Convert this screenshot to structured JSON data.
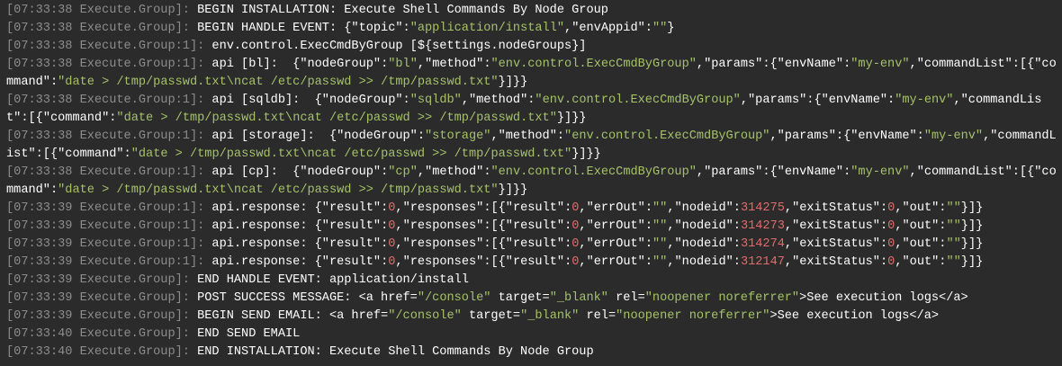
{
  "colors": {
    "background": "#2b2b2b",
    "timestamp": "#8c8c8c",
    "text": "#ffffff",
    "string": "#a5c26a",
    "number": "#e06c6c"
  },
  "lines": [
    {
      "prefix": "[07:33:38 Execute.Group]:",
      "segments": [
        {
          "t": "p",
          "v": " BEGIN INSTALLATION: Execute Shell Commands By Node Group"
        }
      ]
    },
    {
      "prefix": "[07:33:38 Execute.Group]:",
      "segments": [
        {
          "t": "p",
          "v": " BEGIN HANDLE EVENT: {"
        },
        {
          "t": "k",
          "v": "\"topic\""
        },
        {
          "t": "p",
          "v": ":"
        },
        {
          "t": "s",
          "v": "\"application/install\""
        },
        {
          "t": "p",
          "v": ","
        },
        {
          "t": "k",
          "v": "\"envAppid\""
        },
        {
          "t": "p",
          "v": ":"
        },
        {
          "t": "s",
          "v": "\"\""
        },
        {
          "t": "p",
          "v": "}"
        }
      ]
    },
    {
      "prefix": "[07:33:38 Execute.Group:1]:",
      "segments": [
        {
          "t": "p",
          "v": " env.control.ExecCmdByGroup [${settings.nodeGroups}]"
        }
      ]
    },
    {
      "prefix": "[07:33:38 Execute.Group:1]:",
      "segments": [
        {
          "t": "p",
          "v": " api [bl]:  {"
        },
        {
          "t": "k",
          "v": "\"nodeGroup\""
        },
        {
          "t": "p",
          "v": ":"
        },
        {
          "t": "s",
          "v": "\"bl\""
        },
        {
          "t": "p",
          "v": ","
        },
        {
          "t": "k",
          "v": "\"method\""
        },
        {
          "t": "p",
          "v": ":"
        },
        {
          "t": "s",
          "v": "\"env.control.ExecCmdByGroup\""
        },
        {
          "t": "p",
          "v": ","
        },
        {
          "t": "k",
          "v": "\"params\""
        },
        {
          "t": "p",
          "v": ":{"
        },
        {
          "t": "k",
          "v": "\"envName\""
        },
        {
          "t": "p",
          "v": ":"
        },
        {
          "t": "s",
          "v": "\"my-env\""
        },
        {
          "t": "p",
          "v": ","
        },
        {
          "t": "k",
          "v": "\"commandList\""
        },
        {
          "t": "p",
          "v": ":[{"
        },
        {
          "t": "k",
          "v": "\"command\""
        },
        {
          "t": "p",
          "v": ":"
        },
        {
          "t": "s",
          "v": "\"date > /tmp/passwd.txt\\ncat /etc/passwd >> /tmp/passwd.txt\""
        },
        {
          "t": "p",
          "v": "}]}}"
        }
      ]
    },
    {
      "prefix": "[07:33:38 Execute.Group:1]:",
      "segments": [
        {
          "t": "p",
          "v": " api [sqldb]:  {"
        },
        {
          "t": "k",
          "v": "\"nodeGroup\""
        },
        {
          "t": "p",
          "v": ":"
        },
        {
          "t": "s",
          "v": "\"sqldb\""
        },
        {
          "t": "p",
          "v": ","
        },
        {
          "t": "k",
          "v": "\"method\""
        },
        {
          "t": "p",
          "v": ":"
        },
        {
          "t": "s",
          "v": "\"env.control.ExecCmdByGroup\""
        },
        {
          "t": "p",
          "v": ","
        },
        {
          "t": "k",
          "v": "\"params\""
        },
        {
          "t": "p",
          "v": ":{"
        },
        {
          "t": "k",
          "v": "\"envName\""
        },
        {
          "t": "p",
          "v": ":"
        },
        {
          "t": "s",
          "v": "\"my-env\""
        },
        {
          "t": "p",
          "v": ","
        },
        {
          "t": "k",
          "v": "\"commandList\""
        },
        {
          "t": "p",
          "v": ":[{"
        },
        {
          "t": "k",
          "v": "\"command\""
        },
        {
          "t": "p",
          "v": ":"
        },
        {
          "t": "s",
          "v": "\"date > /tmp/passwd.txt\\ncat /etc/passwd >> /tmp/passwd.txt\""
        },
        {
          "t": "p",
          "v": "}]}}"
        }
      ]
    },
    {
      "prefix": "[07:33:38 Execute.Group:1]:",
      "segments": [
        {
          "t": "p",
          "v": " api [storage]:  {"
        },
        {
          "t": "k",
          "v": "\"nodeGroup\""
        },
        {
          "t": "p",
          "v": ":"
        },
        {
          "t": "s",
          "v": "\"storage\""
        },
        {
          "t": "p",
          "v": ","
        },
        {
          "t": "k",
          "v": "\"method\""
        },
        {
          "t": "p",
          "v": ":"
        },
        {
          "t": "s",
          "v": "\"env.control.ExecCmdByGroup\""
        },
        {
          "t": "p",
          "v": ","
        },
        {
          "t": "k",
          "v": "\"params\""
        },
        {
          "t": "p",
          "v": ":{"
        },
        {
          "t": "k",
          "v": "\"envName\""
        },
        {
          "t": "p",
          "v": ":"
        },
        {
          "t": "s",
          "v": "\"my-env\""
        },
        {
          "t": "p",
          "v": ","
        },
        {
          "t": "k",
          "v": "\"commandList\""
        },
        {
          "t": "p",
          "v": ":[{"
        },
        {
          "t": "k",
          "v": "\"command\""
        },
        {
          "t": "p",
          "v": ":"
        },
        {
          "t": "s",
          "v": "\"date > /tmp/passwd.txt\\ncat /etc/passwd >> /tmp/passwd.txt\""
        },
        {
          "t": "p",
          "v": "}]}}"
        }
      ]
    },
    {
      "prefix": "[07:33:38 Execute.Group:1]:",
      "segments": [
        {
          "t": "p",
          "v": " api [cp]:  {"
        },
        {
          "t": "k",
          "v": "\"nodeGroup\""
        },
        {
          "t": "p",
          "v": ":"
        },
        {
          "t": "s",
          "v": "\"cp\""
        },
        {
          "t": "p",
          "v": ","
        },
        {
          "t": "k",
          "v": "\"method\""
        },
        {
          "t": "p",
          "v": ":"
        },
        {
          "t": "s",
          "v": "\"env.control.ExecCmdByGroup\""
        },
        {
          "t": "p",
          "v": ","
        },
        {
          "t": "k",
          "v": "\"params\""
        },
        {
          "t": "p",
          "v": ":{"
        },
        {
          "t": "k",
          "v": "\"envName\""
        },
        {
          "t": "p",
          "v": ":"
        },
        {
          "t": "s",
          "v": "\"my-env\""
        },
        {
          "t": "p",
          "v": ","
        },
        {
          "t": "k",
          "v": "\"commandList\""
        },
        {
          "t": "p",
          "v": ":[{"
        },
        {
          "t": "k",
          "v": "\"command\""
        },
        {
          "t": "p",
          "v": ":"
        },
        {
          "t": "s",
          "v": "\"date > /tmp/passwd.txt\\ncat /etc/passwd >> /tmp/passwd.txt\""
        },
        {
          "t": "p",
          "v": "}]}}"
        }
      ]
    },
    {
      "prefix": "[07:33:39 Execute.Group:1]:",
      "segments": [
        {
          "t": "p",
          "v": " api.response: {"
        },
        {
          "t": "k",
          "v": "\"result\""
        },
        {
          "t": "p",
          "v": ":"
        },
        {
          "t": "n",
          "v": "0"
        },
        {
          "t": "p",
          "v": ","
        },
        {
          "t": "k",
          "v": "\"responses\""
        },
        {
          "t": "p",
          "v": ":[{"
        },
        {
          "t": "k",
          "v": "\"result\""
        },
        {
          "t": "p",
          "v": ":"
        },
        {
          "t": "n",
          "v": "0"
        },
        {
          "t": "p",
          "v": ","
        },
        {
          "t": "k",
          "v": "\"errOut\""
        },
        {
          "t": "p",
          "v": ":"
        },
        {
          "t": "s",
          "v": "\"\""
        },
        {
          "t": "p",
          "v": ","
        },
        {
          "t": "k",
          "v": "\"nodeid\""
        },
        {
          "t": "p",
          "v": ":"
        },
        {
          "t": "n",
          "v": "314275"
        },
        {
          "t": "p",
          "v": ","
        },
        {
          "t": "k",
          "v": "\"exitStatus\""
        },
        {
          "t": "p",
          "v": ":"
        },
        {
          "t": "n",
          "v": "0"
        },
        {
          "t": "p",
          "v": ","
        },
        {
          "t": "k",
          "v": "\"out\""
        },
        {
          "t": "p",
          "v": ":"
        },
        {
          "t": "s",
          "v": "\"\""
        },
        {
          "t": "p",
          "v": "}]}"
        }
      ]
    },
    {
      "prefix": "[07:33:39 Execute.Group:1]:",
      "segments": [
        {
          "t": "p",
          "v": " api.response: {"
        },
        {
          "t": "k",
          "v": "\"result\""
        },
        {
          "t": "p",
          "v": ":"
        },
        {
          "t": "n",
          "v": "0"
        },
        {
          "t": "p",
          "v": ","
        },
        {
          "t": "k",
          "v": "\"responses\""
        },
        {
          "t": "p",
          "v": ":[{"
        },
        {
          "t": "k",
          "v": "\"result\""
        },
        {
          "t": "p",
          "v": ":"
        },
        {
          "t": "n",
          "v": "0"
        },
        {
          "t": "p",
          "v": ","
        },
        {
          "t": "k",
          "v": "\"errOut\""
        },
        {
          "t": "p",
          "v": ":"
        },
        {
          "t": "s",
          "v": "\"\""
        },
        {
          "t": "p",
          "v": ","
        },
        {
          "t": "k",
          "v": "\"nodeid\""
        },
        {
          "t": "p",
          "v": ":"
        },
        {
          "t": "n",
          "v": "314273"
        },
        {
          "t": "p",
          "v": ","
        },
        {
          "t": "k",
          "v": "\"exitStatus\""
        },
        {
          "t": "p",
          "v": ":"
        },
        {
          "t": "n",
          "v": "0"
        },
        {
          "t": "p",
          "v": ","
        },
        {
          "t": "k",
          "v": "\"out\""
        },
        {
          "t": "p",
          "v": ":"
        },
        {
          "t": "s",
          "v": "\"\""
        },
        {
          "t": "p",
          "v": "}]}"
        }
      ]
    },
    {
      "prefix": "[07:33:39 Execute.Group:1]:",
      "segments": [
        {
          "t": "p",
          "v": " api.response: {"
        },
        {
          "t": "k",
          "v": "\"result\""
        },
        {
          "t": "p",
          "v": ":"
        },
        {
          "t": "n",
          "v": "0"
        },
        {
          "t": "p",
          "v": ","
        },
        {
          "t": "k",
          "v": "\"responses\""
        },
        {
          "t": "p",
          "v": ":[{"
        },
        {
          "t": "k",
          "v": "\"result\""
        },
        {
          "t": "p",
          "v": ":"
        },
        {
          "t": "n",
          "v": "0"
        },
        {
          "t": "p",
          "v": ","
        },
        {
          "t": "k",
          "v": "\"errOut\""
        },
        {
          "t": "p",
          "v": ":"
        },
        {
          "t": "s",
          "v": "\"\""
        },
        {
          "t": "p",
          "v": ","
        },
        {
          "t": "k",
          "v": "\"nodeid\""
        },
        {
          "t": "p",
          "v": ":"
        },
        {
          "t": "n",
          "v": "314274"
        },
        {
          "t": "p",
          "v": ","
        },
        {
          "t": "k",
          "v": "\"exitStatus\""
        },
        {
          "t": "p",
          "v": ":"
        },
        {
          "t": "n",
          "v": "0"
        },
        {
          "t": "p",
          "v": ","
        },
        {
          "t": "k",
          "v": "\"out\""
        },
        {
          "t": "p",
          "v": ":"
        },
        {
          "t": "s",
          "v": "\"\""
        },
        {
          "t": "p",
          "v": "}]}"
        }
      ]
    },
    {
      "prefix": "[07:33:39 Execute.Group:1]:",
      "segments": [
        {
          "t": "p",
          "v": " api.response: {"
        },
        {
          "t": "k",
          "v": "\"result\""
        },
        {
          "t": "p",
          "v": ":"
        },
        {
          "t": "n",
          "v": "0"
        },
        {
          "t": "p",
          "v": ","
        },
        {
          "t": "k",
          "v": "\"responses\""
        },
        {
          "t": "p",
          "v": ":[{"
        },
        {
          "t": "k",
          "v": "\"result\""
        },
        {
          "t": "p",
          "v": ":"
        },
        {
          "t": "n",
          "v": "0"
        },
        {
          "t": "p",
          "v": ","
        },
        {
          "t": "k",
          "v": "\"errOut\""
        },
        {
          "t": "p",
          "v": ":"
        },
        {
          "t": "s",
          "v": "\"\""
        },
        {
          "t": "p",
          "v": ","
        },
        {
          "t": "k",
          "v": "\"nodeid\""
        },
        {
          "t": "p",
          "v": ":"
        },
        {
          "t": "n",
          "v": "312147"
        },
        {
          "t": "p",
          "v": ","
        },
        {
          "t": "k",
          "v": "\"exitStatus\""
        },
        {
          "t": "p",
          "v": ":"
        },
        {
          "t": "n",
          "v": "0"
        },
        {
          "t": "p",
          "v": ","
        },
        {
          "t": "k",
          "v": "\"out\""
        },
        {
          "t": "p",
          "v": ":"
        },
        {
          "t": "s",
          "v": "\"\""
        },
        {
          "t": "p",
          "v": "}]}"
        }
      ]
    },
    {
      "prefix": "[07:33:39 Execute.Group]:",
      "segments": [
        {
          "t": "p",
          "v": " END HANDLE EVENT: application/install"
        }
      ]
    },
    {
      "prefix": "[07:33:39 Execute.Group]:",
      "segments": [
        {
          "t": "p",
          "v": " POST SUCCESS MESSAGE: <a href="
        },
        {
          "t": "s",
          "v": "\"/console\""
        },
        {
          "t": "p",
          "v": " target="
        },
        {
          "t": "s",
          "v": "\"_blank\""
        },
        {
          "t": "p",
          "v": " rel="
        },
        {
          "t": "s",
          "v": "\"noopener noreferrer\""
        },
        {
          "t": "p",
          "v": ">See execution logs</a>"
        }
      ]
    },
    {
      "prefix": "[07:33:39 Execute.Group]:",
      "segments": [
        {
          "t": "p",
          "v": " BEGIN SEND EMAIL: <a href="
        },
        {
          "t": "s",
          "v": "\"/console\""
        },
        {
          "t": "p",
          "v": " target="
        },
        {
          "t": "s",
          "v": "\"_blank\""
        },
        {
          "t": "p",
          "v": " rel="
        },
        {
          "t": "s",
          "v": "\"noopener noreferrer\""
        },
        {
          "t": "p",
          "v": ">See execution logs</a>"
        }
      ]
    },
    {
      "prefix": "[07:33:40 Execute.Group]:",
      "segments": [
        {
          "t": "p",
          "v": " END SEND EMAIL"
        }
      ]
    },
    {
      "prefix": "[07:33:40 Execute.Group]:",
      "segments": [
        {
          "t": "p",
          "v": " END INSTALLATION: Execute Shell Commands By Node Group"
        }
      ]
    }
  ]
}
